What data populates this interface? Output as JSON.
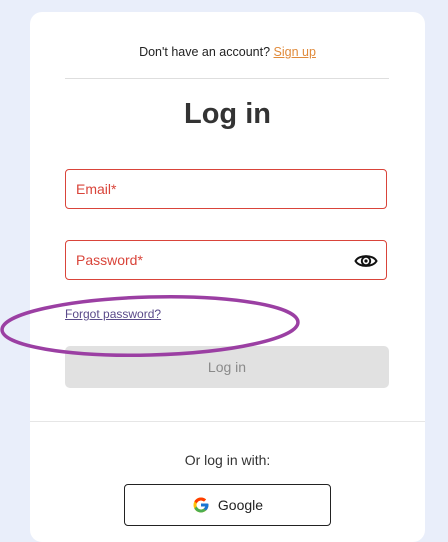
{
  "header": {
    "signup_prompt": "Don't have an account?",
    "signup_link": "Sign up"
  },
  "page_title": "Log in",
  "form": {
    "email_label": "Email*",
    "password_label": "Password*",
    "forgot_password": "Forgot password?",
    "login_button": "Log in"
  },
  "social": {
    "or_text": "Or log in with:",
    "google_label": "Google"
  },
  "colors": {
    "error": "#d9443a",
    "signup_link": "#e08a3a",
    "annotation_ring": "#9b3fa3"
  },
  "icons": {
    "password_toggle": "eye-icon",
    "google": "google-icon"
  }
}
